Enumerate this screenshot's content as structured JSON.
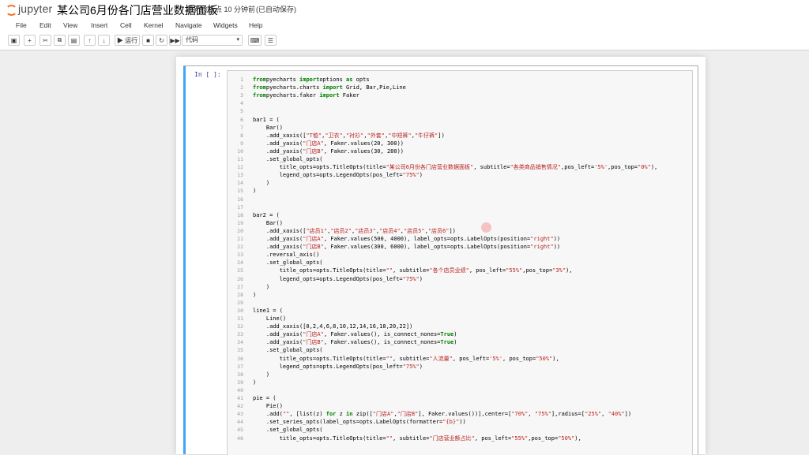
{
  "header": {
    "brand": "jupyter",
    "title": "某公司6月份各门店营业数据面板",
    "checkpoint": "最新检查点 10 分钟前",
    "autosave": "(已自动保存)"
  },
  "menu": [
    "File",
    "Edit",
    "View",
    "Insert",
    "Cell",
    "Kernel",
    "Navigate",
    "Widgets",
    "Help"
  ],
  "toolbar": {
    "run_label": "▶ 运行",
    "cell_type": "代码"
  },
  "cell": {
    "prompt": "In  [  ]:",
    "lines": [
      {
        "n": "1",
        "segs": [
          [
            "kw",
            "from"
          ],
          [
            "",
            "pyecharts "
          ],
          [
            "kw",
            "import"
          ],
          [
            "",
            "options "
          ],
          [
            "kw",
            "as"
          ],
          [
            "",
            " opts"
          ]
        ]
      },
      {
        "n": "2",
        "segs": [
          [
            "kw",
            "from"
          ],
          [
            "",
            "pyecharts.charts "
          ],
          [
            "kw",
            "import"
          ],
          [
            "",
            " Grid, Bar,Pie,Line"
          ]
        ]
      },
      {
        "n": "3",
        "segs": [
          [
            "kw",
            "from"
          ],
          [
            "",
            "pyecharts.faker "
          ],
          [
            "kw",
            "import"
          ],
          [
            "",
            " Faker"
          ]
        ]
      },
      {
        "n": "4",
        "segs": []
      },
      {
        "n": "5",
        "segs": []
      },
      {
        "n": "6",
        "segs": [
          [
            "",
            "bar1 = ("
          ]
        ]
      },
      {
        "n": "7",
        "segs": [
          [
            "",
            "    Bar()"
          ]
        ]
      },
      {
        "n": "8",
        "segs": [
          [
            "",
            "    .add_xaxis(["
          ],
          [
            "str",
            "\"T恤\""
          ],
          [
            "",
            ","
          ],
          [
            "str",
            "\"卫衣\""
          ],
          [
            "",
            ","
          ],
          [
            "str",
            "\"衬衫\""
          ],
          [
            "",
            ","
          ],
          [
            "str",
            "\"外套\""
          ],
          [
            "",
            ","
          ],
          [
            "str",
            "\"中短裤\""
          ],
          [
            "",
            ","
          ],
          [
            "str",
            "\"牛仔裤\""
          ],
          [
            "",
            "])"
          ]
        ]
      },
      {
        "n": "9",
        "segs": [
          [
            "",
            "    .add_yaxis("
          ],
          [
            "str",
            "\"门店A\""
          ],
          [
            "",
            ", Faker.values(20, 300))"
          ]
        ]
      },
      {
        "n": "10",
        "segs": [
          [
            "",
            "    .add_yaxis("
          ],
          [
            "str",
            "\"门店B\""
          ],
          [
            "",
            ", Faker.values(30, 280))"
          ]
        ]
      },
      {
        "n": "11",
        "segs": [
          [
            "",
            "    .set_global_opts("
          ]
        ]
      },
      {
        "n": "12",
        "segs": [
          [
            "",
            "        title_opts=opts.TitleOpts(title="
          ],
          [
            "str",
            "\"某公司6月份各门店营业数据面板\""
          ],
          [
            "",
            ", subtitle="
          ],
          [
            "str",
            "\"各类商品销售情况\""
          ],
          [
            "",
            ",pos_left="
          ],
          [
            "str",
            "'5%'"
          ],
          [
            "",
            ",pos_top="
          ],
          [
            "str",
            "\"0%\""
          ],
          [
            "",
            "),"
          ]
        ]
      },
      {
        "n": "13",
        "segs": [
          [
            "",
            "        legend_opts=opts.LegendOpts(pos_left="
          ],
          [
            "str",
            "\"75%\""
          ],
          [
            "",
            ")"
          ]
        ]
      },
      {
        "n": "14",
        "segs": [
          [
            "",
            "    )"
          ]
        ]
      },
      {
        "n": "15",
        "segs": [
          [
            "",
            ")"
          ]
        ]
      },
      {
        "n": "16",
        "segs": []
      },
      {
        "n": "17",
        "segs": []
      },
      {
        "n": "18",
        "segs": [
          [
            "",
            "bar2 = ("
          ]
        ]
      },
      {
        "n": "19",
        "segs": [
          [
            "",
            "    Bar()"
          ]
        ]
      },
      {
        "n": "20",
        "segs": [
          [
            "",
            "    .add_xaxis(["
          ],
          [
            "str",
            "\"店员1\""
          ],
          [
            "",
            ","
          ],
          [
            "str",
            "\"店员2\""
          ],
          [
            "",
            ","
          ],
          [
            "str",
            "\"店员3\""
          ],
          [
            "",
            ","
          ],
          [
            "str",
            "\"店员4\""
          ],
          [
            "",
            ","
          ],
          [
            "str",
            "\"店员5\""
          ],
          [
            "",
            ","
          ],
          [
            "str",
            "\"店员6\""
          ],
          [
            "",
            "])"
          ]
        ]
      },
      {
        "n": "21",
        "segs": [
          [
            "",
            "    .add_yaxis("
          ],
          [
            "str",
            "\"门店A\""
          ],
          [
            "",
            ", Faker.values(500, 4000), label_opts=opts.LabelOpts(position="
          ],
          [
            "str",
            "\"right\""
          ],
          [
            "",
            "))"
          ]
        ]
      },
      {
        "n": "22",
        "segs": [
          [
            "",
            "    .add_yaxis("
          ],
          [
            "str",
            "\"门店B\""
          ],
          [
            "",
            ", Faker.values(300, 6000), label_opts=opts.LabelOpts(position="
          ],
          [
            "str",
            "\"right\""
          ],
          [
            "",
            "))"
          ]
        ]
      },
      {
        "n": "23",
        "segs": [
          [
            "",
            "    .reversal_axis()"
          ]
        ]
      },
      {
        "n": "24",
        "segs": [
          [
            "",
            "    .set_global_opts("
          ]
        ]
      },
      {
        "n": "25",
        "segs": [
          [
            "",
            "        title_opts=opts.TitleOpts(title="
          ],
          [
            "str",
            "\"\""
          ],
          [
            "",
            ", subtitle="
          ],
          [
            "str",
            "\"各个店员业绩\""
          ],
          [
            "",
            ", pos_left="
          ],
          [
            "str",
            "\"55%\""
          ],
          [
            "",
            ",pos_top="
          ],
          [
            "str",
            "\"3%\""
          ],
          [
            "",
            "),"
          ]
        ]
      },
      {
        "n": "26",
        "segs": [
          [
            "",
            "        legend_opts=opts.LegendOpts(pos_left="
          ],
          [
            "str",
            "\"75%\""
          ],
          [
            "",
            ")"
          ]
        ]
      },
      {
        "n": "27",
        "segs": [
          [
            "",
            "    )"
          ]
        ]
      },
      {
        "n": "28",
        "segs": [
          [
            "",
            ")"
          ]
        ]
      },
      {
        "n": "29",
        "segs": []
      },
      {
        "n": "30",
        "segs": [
          [
            "",
            "line1 = ("
          ]
        ]
      },
      {
        "n": "31",
        "segs": [
          [
            "",
            "    Line()"
          ]
        ]
      },
      {
        "n": "32",
        "segs": [
          [
            "",
            "    .add_xaxis([0,2,4,6,8,10,12,14,16,18,20,22])"
          ]
        ]
      },
      {
        "n": "33",
        "segs": [
          [
            "",
            "    .add_yaxis("
          ],
          [
            "str",
            "\"门店A\""
          ],
          [
            "",
            ", Faker.values(), is_connect_nones="
          ],
          [
            "kw",
            "True"
          ],
          [
            "",
            ")"
          ]
        ]
      },
      {
        "n": "34",
        "segs": [
          [
            "",
            "    .add_yaxis("
          ],
          [
            "str",
            "\"门店B\""
          ],
          [
            "",
            ", Faker.values(), is_connect_nones="
          ],
          [
            "kw",
            "True"
          ],
          [
            "",
            ")"
          ]
        ]
      },
      {
        "n": "35",
        "segs": [
          [
            "",
            "    .set_global_opts("
          ]
        ]
      },
      {
        "n": "36",
        "segs": [
          [
            "",
            "        title_opts=opts.TitleOpts(title="
          ],
          [
            "str",
            "\"\""
          ],
          [
            "",
            ", subtitle="
          ],
          [
            "str",
            "\"人流量\""
          ],
          [
            "",
            ", pos_left="
          ],
          [
            "str",
            "'5%'"
          ],
          [
            "",
            ", pos_top="
          ],
          [
            "str",
            "\"50%\""
          ],
          [
            "",
            "),"
          ]
        ]
      },
      {
        "n": "37",
        "segs": [
          [
            "",
            "        legend_opts=opts.LegendOpts(pos_left="
          ],
          [
            "str",
            "\"75%\""
          ],
          [
            "",
            ")"
          ]
        ]
      },
      {
        "n": "38",
        "segs": [
          [
            "",
            "    )"
          ]
        ]
      },
      {
        "n": "39",
        "segs": [
          [
            "",
            ")"
          ]
        ]
      },
      {
        "n": "40",
        "segs": []
      },
      {
        "n": "41",
        "segs": [
          [
            "",
            "pie = ("
          ]
        ]
      },
      {
        "n": "42",
        "segs": [
          [
            "",
            "    Pie()"
          ]
        ]
      },
      {
        "n": "43",
        "segs": [
          [
            "",
            "    .add("
          ],
          [
            "str",
            "\"\""
          ],
          [
            "",
            ", [list(z) "
          ],
          [
            "kw",
            "for"
          ],
          [
            "",
            " z "
          ],
          [
            "kw",
            "in"
          ],
          [
            "",
            " zip(["
          ],
          [
            "str",
            "\"门店A\""
          ],
          [
            "",
            ","
          ],
          [
            "str",
            "\"门店B\""
          ],
          [
            "",
            "], Faker.values())],center=["
          ],
          [
            "str",
            "\"70%\""
          ],
          [
            "",
            ", "
          ],
          [
            "str",
            "\"75%\""
          ],
          [
            "",
            "],radius=["
          ],
          [
            "str",
            "\"25%\""
          ],
          [
            "",
            ", "
          ],
          [
            "str",
            "\"40%\""
          ],
          [
            "",
            "])"
          ]
        ]
      },
      {
        "n": "44",
        "segs": [
          [
            "",
            "    .set_series_opts(label_opts=opts.LabelOpts(formatter="
          ],
          [
            "str",
            "\"{b}\""
          ],
          [
            "",
            "))"
          ]
        ]
      },
      {
        "n": "45",
        "segs": [
          [
            "",
            "    .set_global_opts("
          ]
        ]
      },
      {
        "n": "46",
        "segs": [
          [
            "",
            "        title_opts=opts.TitleOpts(title="
          ],
          [
            "str",
            "\"\""
          ],
          [
            "",
            ", subtitle="
          ],
          [
            "str",
            "\"门店营业额占比\""
          ],
          [
            "",
            ", pos_left="
          ],
          [
            "str",
            "\"55%\""
          ],
          [
            "",
            ",pos_top="
          ],
          [
            "str",
            "\"50%\""
          ],
          [
            "",
            "),"
          ]
        ]
      }
    ]
  }
}
